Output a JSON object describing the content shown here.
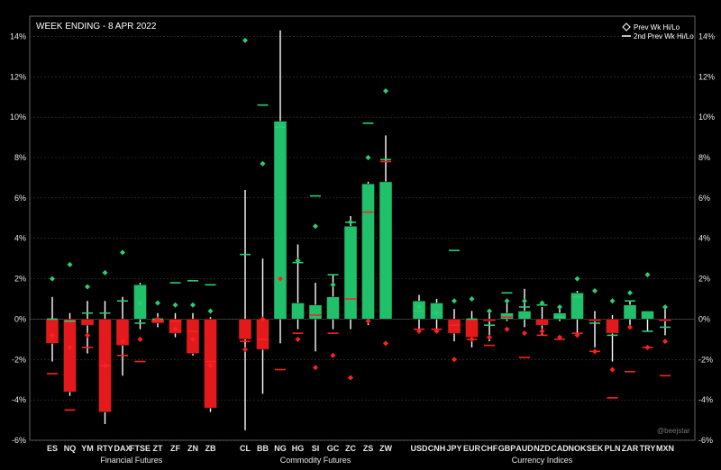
{
  "chart_data": {
    "type": "bar",
    "title": "WEEK ENDING - 8 APR 2022",
    "watermark": "@beejstar",
    "ylim": [
      -6,
      15
    ],
    "yticks": [
      "-6%",
      "-4%",
      "-2%",
      "0%",
      "2%",
      "4%",
      "6%",
      "8%",
      "10%",
      "12%",
      "14%"
    ],
    "legend": {
      "placement": "top-right",
      "entries": [
        "Prev Wk Hi/Lo",
        "2nd Prev Wk Hi/Lo"
      ]
    },
    "groups": [
      {
        "label": "Financial Futures",
        "categories": [
          "ES",
          "NQ",
          "YM",
          "RTY",
          "DAX",
          "FTSE",
          "ZT",
          "ZF",
          "ZN",
          "ZB"
        ]
      },
      {
        "label": "Commodity Futures",
        "categories": [
          "CL",
          "BB",
          "NG",
          "HG",
          "SI",
          "GC",
          "ZC",
          "ZS",
          "ZW"
        ]
      },
      {
        "label": "Currency Indices",
        "categories": [
          "USD",
          "CNH",
          "JPY",
          "EUR",
          "CHF",
          "GBP",
          "AUD",
          "NZD",
          "CAD",
          "NOK",
          "SEK",
          "PLN",
          "ZAR",
          "TRY",
          "MXN"
        ]
      }
    ],
    "series": [
      {
        "category": "ES",
        "value": -1.2,
        "high": 1.1,
        "low": -2.1,
        "prev_hi": 2.0,
        "prev_lo": -0.8,
        "prev2_hi": 0.0,
        "prev2_lo": -2.7
      },
      {
        "category": "NQ",
        "value": -3.6,
        "high": 0.3,
        "low": -3.8,
        "prev_hi": 2.7,
        "prev_lo": -1.4,
        "prev2_hi": -0.1,
        "prev2_lo": -4.5
      },
      {
        "category": "YM",
        "value": -0.3,
        "high": 0.9,
        "low": -1.7,
        "prev_hi": 1.6,
        "prev_lo": -0.8,
        "prev2_hi": 0.3,
        "prev2_lo": -1.4
      },
      {
        "category": "RTY",
        "value": -4.6,
        "high": 0.9,
        "low": -5.2,
        "prev_hi": 2.3,
        "prev_lo": -2.3,
        "prev2_hi": 0.3,
        "prev2_lo": -2.3
      },
      {
        "category": "DAX",
        "value": -1.3,
        "high": 1.1,
        "low": -2.8,
        "prev_hi": 3.3,
        "prev_lo": -1.1,
        "prev2_hi": 0.9,
        "prev2_lo": -1.8
      },
      {
        "category": "FTSE",
        "value": 1.7,
        "high": 1.8,
        "low": -0.5,
        "prev_hi": 0.8,
        "prev_lo": -1.0,
        "prev2_hi": -0.2,
        "prev2_lo": -2.1
      },
      {
        "category": "ZT",
        "value": -0.2,
        "high": 0.3,
        "low": -0.4,
        "prev_hi": 0.8,
        "prev_lo": 0.0,
        "prev2_hi": 0.0,
        "prev2_lo": -0.1
      },
      {
        "category": "ZF",
        "value": -0.7,
        "high": 0.3,
        "low": -0.9,
        "prev_hi": 0.7,
        "prev_lo": -0.5,
        "prev2_hi": 1.8,
        "prev2_lo": -0.1
      },
      {
        "category": "ZN",
        "value": -1.7,
        "high": 0.3,
        "low": -1.8,
        "prev_hi": 0.7,
        "prev_lo": -1.0,
        "prev2_hi": 1.9,
        "prev2_lo": -0.6
      },
      {
        "category": "ZB",
        "value": -4.4,
        "high": 0.1,
        "low": -4.6,
        "prev_hi": 0.4,
        "prev_lo": -2.3,
        "prev2_hi": 1.7,
        "prev2_lo": -2.1
      },
      {
        "category": "CL",
        "value": -1.0,
        "high": 6.4,
        "low": -5.5,
        "prev_hi": 13.8,
        "prev_lo": -1.5,
        "prev2_hi": 3.2,
        "prev2_lo": -1.1
      },
      {
        "category": "BB",
        "value": -1.5,
        "high": 3.0,
        "low": -3.7,
        "prev_hi": 7.7,
        "prev_lo": 0.0,
        "prev2_hi": 10.6,
        "prev2_lo": -1.0
      },
      {
        "category": "NG",
        "value": 9.8,
        "high": 14.3,
        "low": -1.2,
        "prev_hi": 2.0,
        "prev_lo": 2.0,
        "prev2_hi": 9.5,
        "prev2_lo": -2.5
      },
      {
        "category": "HG",
        "value": 0.8,
        "high": 3.7,
        "low": -0.5,
        "prev_hi": 2.9,
        "prev_lo": -1.0,
        "prev2_hi": 2.8,
        "prev2_lo": -0.7
      },
      {
        "category": "SI",
        "value": 0.7,
        "high": 1.8,
        "low": -1.6,
        "prev_hi": 4.6,
        "prev_lo": -2.4,
        "prev2_hi": 6.1,
        "prev2_lo": 0.2
      },
      {
        "category": "GC",
        "value": 1.1,
        "high": 2.2,
        "low": -0.5,
        "prev_hi": 1.7,
        "prev_lo": -1.8,
        "prev2_hi": 2.2,
        "prev2_lo": -0.7
      },
      {
        "category": "ZC",
        "value": 4.6,
        "high": 5.1,
        "low": -0.5,
        "prev_hi": 4.8,
        "prev_lo": -2.9,
        "prev2_hi": 4.8,
        "prev2_lo": 1.0
      },
      {
        "category": "ZS",
        "value": 6.7,
        "high": 6.8,
        "low": -0.3,
        "prev_hi": 8.0,
        "prev_lo": -0.1,
        "prev2_hi": 9.7,
        "prev2_lo": 5.3
      },
      {
        "category": "ZW",
        "value": 6.8,
        "high": 9.1,
        "low": 0.0,
        "prev_hi": 11.3,
        "prev_lo": -1.2,
        "prev2_hi": 7.9,
        "prev2_lo": 7.8
      },
      {
        "category": "USD",
        "value": 0.9,
        "high": 1.2,
        "low": -0.5,
        "prev_hi": 0.6,
        "prev_lo": -0.6,
        "prev2_hi": 0.4,
        "prev2_lo": -0.5
      },
      {
        "category": "CNH",
        "value": 0.8,
        "high": 1.0,
        "low": -0.6,
        "prev_hi": 0.3,
        "prev_lo": -0.6,
        "prev2_hi": 0.3,
        "prev2_lo": -0.5
      },
      {
        "category": "JPY",
        "value": -0.7,
        "high": 0.5,
        "low": -1.1,
        "prev_hi": 0.9,
        "prev_lo": -2.0,
        "prev2_hi": 3.4,
        "prev2_lo": -0.3
      },
      {
        "category": "EUR",
        "value": -0.9,
        "high": 0.4,
        "low": -1.4,
        "prev_hi": 1.0,
        "prev_lo": -1.0,
        "prev2_hi": 0.0,
        "prev2_lo": -1.0
      },
      {
        "category": "CHF",
        "value": -0.1,
        "high": 0.3,
        "low": -1.1,
        "prev_hi": 0.4,
        "prev_lo": -0.9,
        "prev2_hi": -0.3,
        "prev2_lo": -1.3
      },
      {
        "category": "GBP",
        "value": 0.3,
        "high": 0.9,
        "low": -0.1,
        "prev_hi": 0.9,
        "prev_lo": -0.5,
        "prev2_hi": 1.3,
        "prev2_lo": 0.1
      },
      {
        "category": "AUD",
        "value": 0.4,
        "high": 1.5,
        "low": -0.4,
        "prev_hi": 0.9,
        "prev_lo": -0.7,
        "prev2_hi": 0.6,
        "prev2_lo": -1.9
      },
      {
        "category": "NZD",
        "value": -0.3,
        "high": 0.6,
        "low": -0.8,
        "prev_hi": 0.8,
        "prev_lo": -0.6,
        "prev2_hi": 0.7,
        "prev2_lo": -0.8
      },
      {
        "category": "CAD",
        "value": 0.3,
        "high": 0.6,
        "low": -0.1,
        "prev_hi": 0.6,
        "prev_lo": -0.9,
        "prev2_hi": 0.1,
        "prev2_lo": -1.0
      },
      {
        "category": "NOK",
        "value": 1.3,
        "high": 1.4,
        "low": -0.9,
        "prev_hi": 2.0,
        "prev_lo": -0.8,
        "prev2_hi": 1.1,
        "prev2_lo": -0.7
      },
      {
        "category": "SEK",
        "value": -0.1,
        "high": 0.4,
        "low": -1.4,
        "prev_hi": 1.4,
        "prev_lo": -1.6,
        "prev2_hi": -0.2,
        "prev2_lo": -1.6
      },
      {
        "category": "PLN",
        "value": -0.7,
        "high": 0.2,
        "low": -2.1,
        "prev_hi": 0.9,
        "prev_lo": -2.5,
        "prev2_hi": -0.8,
        "prev2_lo": -3.9
      },
      {
        "category": "ZAR",
        "value": 0.7,
        "high": 0.9,
        "low": -0.4,
        "prev_hi": 1.3,
        "prev_lo": -0.4,
        "prev2_hi": 0.9,
        "prev2_lo": -2.6
      },
      {
        "category": "TRY",
        "value": 0.4,
        "high": 0.4,
        "low": -0.6,
        "prev_hi": 2.2,
        "prev_lo": -1.4,
        "prev2_hi": -0.6,
        "prev2_lo": -1.4
      },
      {
        "category": "MXN",
        "value": -0.1,
        "high": 0.6,
        "low": -0.8,
        "prev_hi": 0.6,
        "prev_lo": -1.1,
        "prev2_hi": -0.4,
        "prev2_lo": -2.8
      }
    ],
    "colors": {
      "background": "#000000",
      "grid": "#3a3a3a",
      "up": "#21c06b",
      "down": "#e3191c",
      "up_marker": "#2ecc71",
      "down_marker": "#ff2020",
      "wick": "#ffffff"
    },
    "grid": true
  }
}
